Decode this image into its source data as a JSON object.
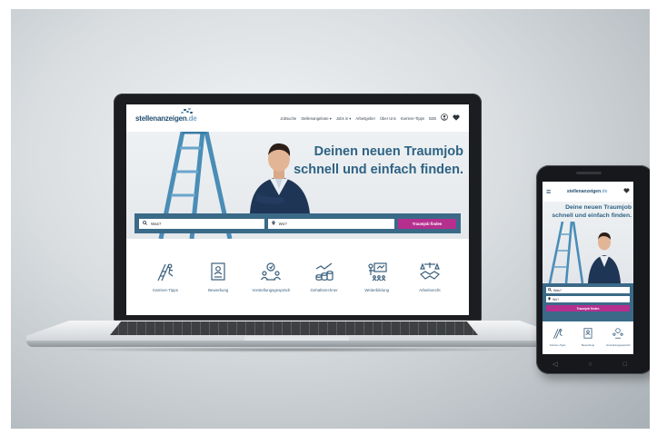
{
  "colors": {
    "brand_blue": "#2e6384",
    "search_bar": "#3b6a88",
    "cta_magenta": "#b52f8f",
    "icon_blue": "#3a5f7d"
  },
  "logo": {
    "name": "stellenanzeigen",
    "tld": ".de"
  },
  "nav": {
    "items": [
      "Jobsuche",
      "Stellenangebote ▾",
      "Jobs in ▾",
      "Arbeitgeber",
      "Über Uns",
      "Karriere-Tipps",
      "B2B"
    ],
    "user_icon": "user-circle-icon",
    "heart_icon": "heart-icon"
  },
  "hero": {
    "title_line1": "Deinen neuen Traumjob",
    "title_line2": "schnell und einfach finden."
  },
  "search": {
    "what_placeholder": "Was?",
    "where_placeholder": "Wo?",
    "button_label": "Traumjob finden"
  },
  "categories": [
    {
      "label": "Karriere-Tipps",
      "icon": "ladder-person-icon"
    },
    {
      "label": "Bewerbung",
      "icon": "resume-document-icon"
    },
    {
      "label": "Vorstellungsgespräch",
      "icon": "interview-people-icon"
    },
    {
      "label": "Gehaltsrechner",
      "icon": "coins-chart-icon"
    },
    {
      "label": "Weiterbildung",
      "icon": "presentation-board-icon"
    },
    {
      "label": "Arbeitsrecht",
      "icon": "handshake-icon"
    }
  ],
  "phone": {
    "title_line1": "Deine neuen Traumjob",
    "title_line2": "schnell und einfach finden.",
    "what_placeholder": "Was?",
    "where_placeholder": "Wo?",
    "button_label": "Traumjob finden",
    "categories": [
      "Karriere-Tipps",
      "Bewerbung",
      "Vorstellungsgespräch"
    ]
  }
}
